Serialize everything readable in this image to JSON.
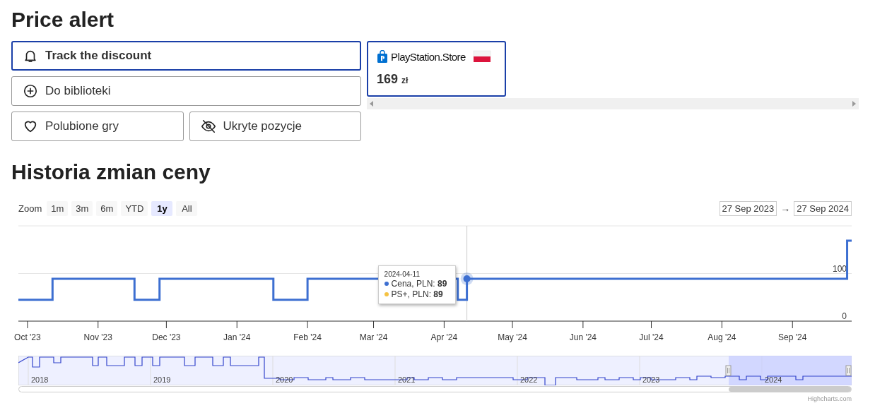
{
  "title": "Price alert",
  "actions": [
    {
      "label": "Track the discount",
      "selected": true
    },
    {
      "label": "Do biblioteki",
      "selected": false
    },
    {
      "label": "Polubione gry",
      "selected": false
    },
    {
      "label": "Ukryte pozycje",
      "selected": false
    }
  ],
  "stores": [
    {
      "name": "PlayStation.Store",
      "price": "169",
      "currency": "zł",
      "selected": true
    }
  ],
  "history": {
    "title": "Historia zmian ceny",
    "zoom": {
      "label": "Zoom",
      "options": [
        {
          "label": "1m",
          "selected": false
        },
        {
          "label": "3m",
          "selected": false
        },
        {
          "label": "6m",
          "selected": false
        },
        {
          "label": "YTD",
          "selected": false
        },
        {
          "label": "1y",
          "selected": true
        },
        {
          "label": "All",
          "selected": false
        }
      ]
    },
    "range": {
      "from": "27 Sep 2023",
      "arrow": "→",
      "to": "27 Sep 2024"
    },
    "chart_data": {
      "type": "line",
      "x": [
        "2023-09-27",
        "2023-10-12",
        "2023-10-12",
        "2023-11-17",
        "2023-11-17",
        "2023-11-28",
        "2023-11-28",
        "2024-01-17",
        "2024-01-17",
        "2024-02-01",
        "2024-02-01",
        "2024-04-07",
        "2024-04-07",
        "2024-04-11",
        "2024-04-11",
        "2024-09-25",
        "2024-09-25",
        "2024-09-27"
      ],
      "series": [
        {
          "name": "Cena, PLN",
          "color": "#3d6fd1",
          "values": [
            45,
            45,
            89,
            89,
            45,
            45,
            89,
            89,
            45,
            45,
            89,
            89,
            45,
            45,
            89,
            89,
            169,
            169
          ]
        }
      ],
      "ref_lines": [
        {
          "axis": "x",
          "value": "2024-04-11",
          "color": "#cccccc"
        }
      ],
      "xlim": [
        "2023-09-27",
        "2024-09-27"
      ],
      "ylim": [
        0,
        200
      ],
      "yticks": [
        0,
        100
      ],
      "xticks": [
        {
          "value": "2023-10-01",
          "label": "Oct '23"
        },
        {
          "value": "2023-11-01",
          "label": "Nov '23"
        },
        {
          "value": "2023-12-01",
          "label": "Dec '23"
        },
        {
          "value": "2024-01-01",
          "label": "Jan '24"
        },
        {
          "value": "2024-02-01",
          "label": "Feb '24"
        },
        {
          "value": "2024-03-01",
          "label": "Mar '24"
        },
        {
          "value": "2024-04-01",
          "label": "Apr '24"
        },
        {
          "value": "2024-05-01",
          "label": "May '24"
        },
        {
          "value": "2024-06-01",
          "label": "Jun '24"
        },
        {
          "value": "2024-07-01",
          "label": "Jul '24"
        },
        {
          "value": "2024-08-01",
          "label": "Aug '24"
        },
        {
          "value": "2024-09-01",
          "label": "Sep '24"
        }
      ]
    },
    "tooltip": {
      "date": "2024-04-11",
      "items": [
        {
          "sep": ":",
          "value": "89",
          "color": "#3d6fd1"
        },
        {
          "name": "PS+, PLN",
          "sep": ":",
          "value": "89",
          "color": "#f5c242"
        }
      ]
    },
    "navigator": {
      "years": [
        "2018",
        "2019",
        "2020",
        "2021",
        "2022",
        "2023",
        "2024"
      ]
    },
    "credits": "Highcharts.com"
  }
}
